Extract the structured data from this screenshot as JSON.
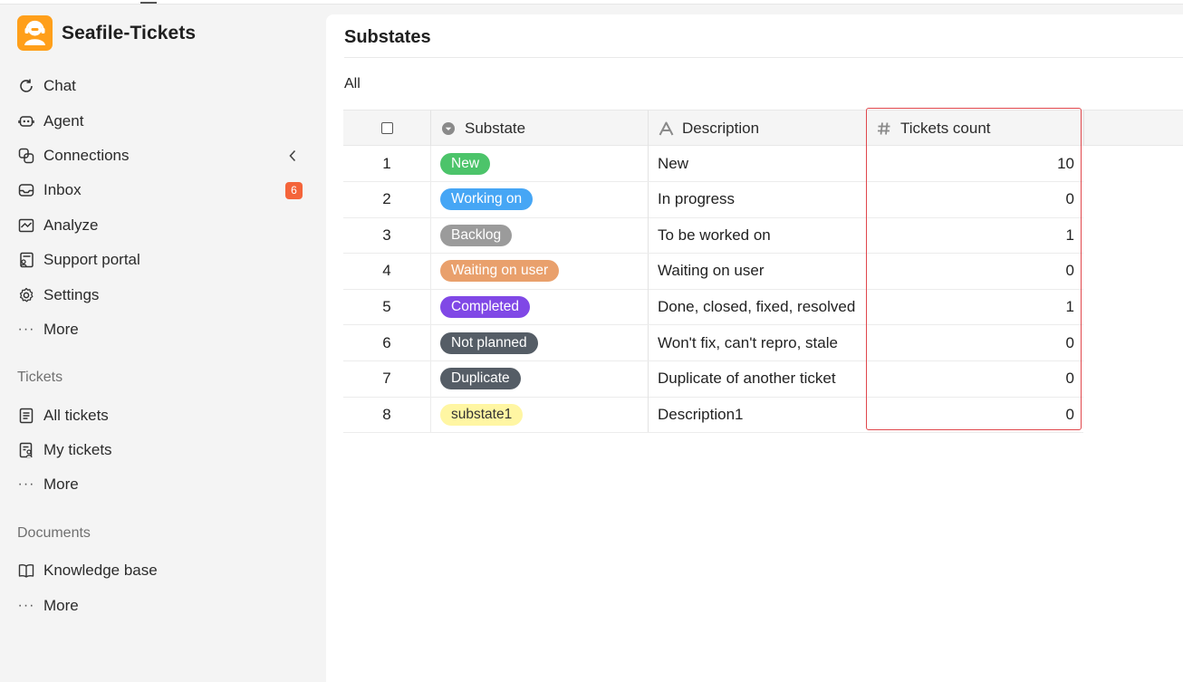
{
  "app": {
    "name": "Seafile-Tickets"
  },
  "colors": {
    "accent": "#ff9f1a",
    "badge": "#f4643a",
    "highlight": "#e0474c"
  },
  "sidebar": {
    "main_items": [
      {
        "label": "Chat",
        "icon": "chat-refresh-icon"
      },
      {
        "label": "Agent",
        "icon": "robot-icon"
      },
      {
        "label": "Connections",
        "icon": "link-icon"
      },
      {
        "label": "Inbox",
        "icon": "inbox-icon",
        "badge": "6"
      },
      {
        "label": "Analyze",
        "icon": "chart-icon"
      },
      {
        "label": "Support portal",
        "icon": "portal-icon"
      },
      {
        "label": "Settings",
        "icon": "gear-icon"
      },
      {
        "label": "More",
        "icon": "dots-icon"
      }
    ],
    "tickets_section": {
      "title": "Tickets",
      "items": [
        {
          "label": "All tickets",
          "icon": "list-icon"
        },
        {
          "label": "My tickets",
          "icon": "user-list-icon"
        },
        {
          "label": "More",
          "icon": "dots-icon"
        }
      ]
    },
    "documents_section": {
      "title": "Documents",
      "items": [
        {
          "label": "Knowledge base",
          "icon": "book-icon"
        },
        {
          "label": "More",
          "icon": "dots-icon"
        }
      ]
    }
  },
  "page": {
    "title": "Substates",
    "view_tab": "All"
  },
  "table": {
    "columns": [
      "Substate",
      "Description",
      "Tickets count"
    ],
    "rows": [
      {
        "index": "1",
        "substate": "New",
        "color": "#4cc46a",
        "text_color": "#ffffff",
        "description": "New",
        "count": "10"
      },
      {
        "index": "2",
        "substate": "Working on",
        "color": "#46a6f5",
        "text_color": "#ffffff",
        "description": "In progress",
        "count": "0"
      },
      {
        "index": "3",
        "substate": "Backlog",
        "color": "#9b9b9b",
        "text_color": "#ffffff",
        "description": "To be worked on",
        "count": "1"
      },
      {
        "index": "4",
        "substate": "Waiting on user",
        "color": "#e9a06c",
        "text_color": "#ffffff",
        "description": "Waiting on user",
        "count": "0"
      },
      {
        "index": "5",
        "substate": "Completed",
        "color": "#8048e6",
        "text_color": "#ffffff",
        "description": "Done, closed, fixed, resolved",
        "count": "1"
      },
      {
        "index": "6",
        "substate": "Not planned",
        "color": "#555d66",
        "text_color": "#ffffff",
        "description": "Won't fix, can't repro, stale",
        "count": "0"
      },
      {
        "index": "7",
        "substate": "Duplicate",
        "color": "#555d66",
        "text_color": "#ffffff",
        "description": "Duplicate of another ticket",
        "count": "0"
      },
      {
        "index": "8",
        "substate": "substate1",
        "color": "#fff6a3",
        "text_color": "#333333",
        "description": "Description1",
        "count": "0"
      }
    ]
  }
}
